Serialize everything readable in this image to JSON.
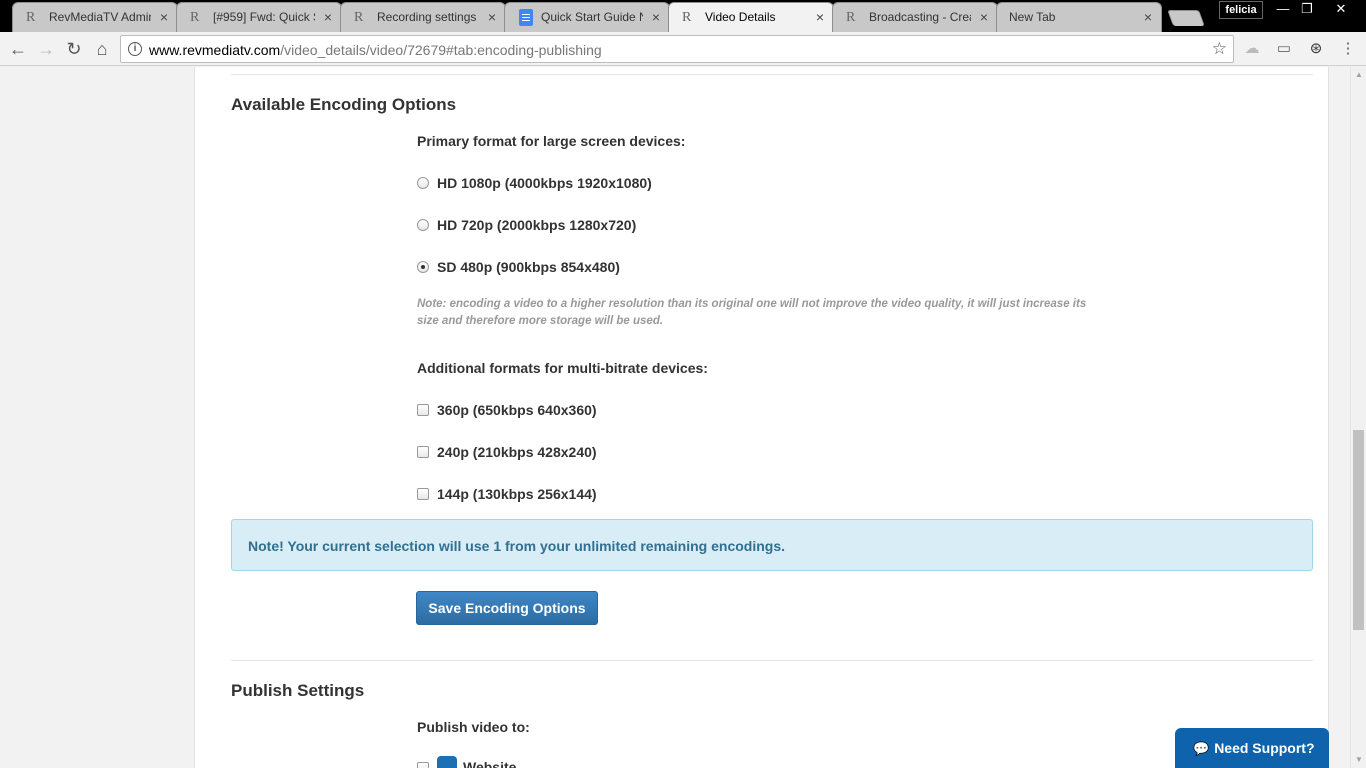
{
  "browser": {
    "tabs": [
      {
        "title": "RevMediaTV Admin",
        "icon": "revmedia-favicon"
      },
      {
        "title": "[#959] Fwd: Quick S",
        "icon": "revmedia-favicon"
      },
      {
        "title": "Recording settings",
        "icon": "revmedia-favicon"
      },
      {
        "title": "Quick Start Guide N",
        "icon": "google-docs-favicon"
      },
      {
        "title": "Video Details",
        "icon": "revmedia-favicon",
        "active": true
      },
      {
        "title": "Broadcasting - Crea",
        "icon": "revmedia-favicon"
      },
      {
        "title": "New Tab",
        "icon": ""
      }
    ],
    "tab_close": "×",
    "favicon_text": "R",
    "profile": "felicia",
    "window_min": "—",
    "window_restore": "❐",
    "window_close": "✕",
    "url_host": "www.revmediatv.com",
    "url_path": "/video_details/video/72679#tab:encoding-publishing",
    "icons": {
      "back": "←",
      "forward": "→",
      "reload": "↻",
      "home": "⌂",
      "info": "i",
      "star": "☆",
      "cloud": "☁",
      "cast": "▭",
      "extension": "⊛",
      "menu": "⋮"
    }
  },
  "encoding": {
    "heading": "Available Encoding Options",
    "primary_label": "Primary format for large screen devices:",
    "primary_options": [
      {
        "label": "HD 1080p (4000kbps 1920x1080)",
        "checked": false
      },
      {
        "label": "HD 720p (2000kbps 1280x720)",
        "checked": false
      },
      {
        "label": "SD 480p (900kbps 854x480)",
        "checked": true
      }
    ],
    "note_line1": "Note: encoding a video to a higher resolution than its original one will not improve the video quality, it will just increase its",
    "note_line2": "size and therefore more storage will be used.",
    "additional_label": "Additional formats for multi-bitrate devices:",
    "additional_options": [
      {
        "label": "360p (650kbps 640x360)",
        "checked": false
      },
      {
        "label": "240p (210kbps 428x240)",
        "checked": false
      },
      {
        "label": "144p (130kbps 256x144)",
        "checked": false
      }
    ],
    "alert": "Note! Your current selection will use 1 from your unlimited remaining encodings.",
    "save_label": "Save Encoding Options"
  },
  "publish": {
    "heading": "Publish Settings",
    "label": "Publish video to:",
    "first_option": "Website"
  },
  "support": {
    "label": "Need Support?",
    "icon": "chat-icon"
  },
  "scrollbar": {
    "up": "▲",
    "down": "▼"
  }
}
